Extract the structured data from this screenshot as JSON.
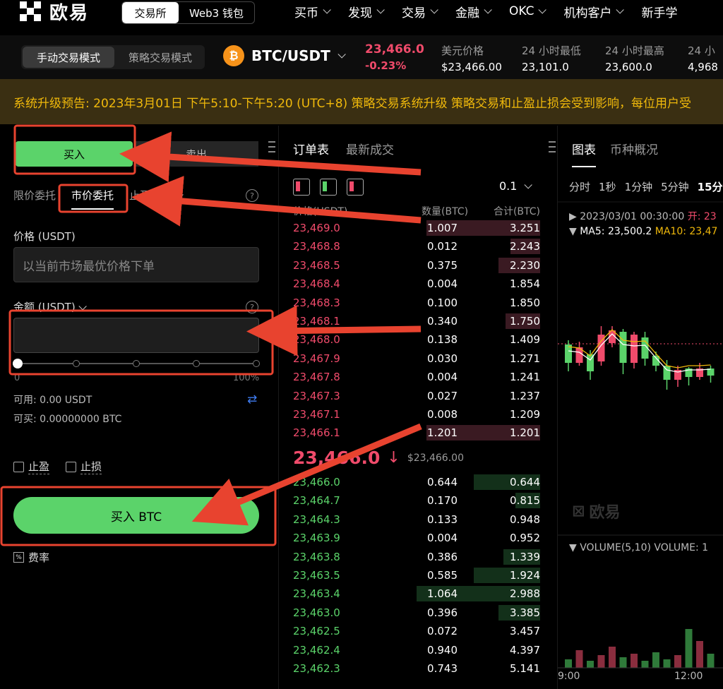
{
  "nav": {
    "logo_text": "欧易",
    "exchange_tab": "交易所",
    "web3_tab": "Web3 钱包",
    "menu": [
      "买币",
      "发现",
      "交易",
      "金融",
      "OKC",
      "机构客户",
      "新手学"
    ]
  },
  "ticker": {
    "mode_manual": "手动交易模式",
    "mode_strategy": "策略交易模式",
    "coin_symbol": "₿",
    "pair": "BTC/USDT",
    "last_price": "23,466.0",
    "change": "-0.23%",
    "stats": [
      {
        "label": "美元价格",
        "value": "$23,466.00"
      },
      {
        "label": "24 小时最低",
        "value": "23,101.0"
      },
      {
        "label": "24 小时最高",
        "value": "23,600.0"
      },
      {
        "label": "24 小",
        "value": "4,968"
      }
    ]
  },
  "announcement": "系统升级预告: 2023年3月01日 下午5:10-下午5:20 (UTC+8) 策略交易系统升级 策略交易和止盈止损会受到影响，每位用户受",
  "order": {
    "buy_tab": "买入",
    "sell_tab": "卖出",
    "type_limit": "限价委托",
    "type_market": "市价委托",
    "type_tpsl": "止盈止损",
    "price_label": "价格 (USDT)",
    "price_placeholder": "以当前市场最优价格下单",
    "amount_label": "金额 (USDT)",
    "slider_min": "0",
    "slider_max": "100%",
    "slider_value": 0,
    "available": "可用: 0.00 USDT",
    "can_buy": "可买: 0.00000000 BTC",
    "take_profit": "止盈",
    "stop_loss": "止损",
    "submit": "买入 BTC",
    "fee": "费率"
  },
  "book": {
    "tab_orderbook": "订单表",
    "tab_trades": "最新成交",
    "precision": "0.1",
    "col_price": "价格(USDT)",
    "col_amount": "数量(BTC)",
    "col_total": "合计(BTC)",
    "asks": [
      {
        "price": "23,469.0",
        "amount": "1.007",
        "total": "3.251",
        "depth": 0.46
      },
      {
        "price": "23,468.8",
        "amount": "0.012",
        "total": "2.243",
        "depth": 0.12
      },
      {
        "price": "23,468.5",
        "amount": "0.375",
        "total": "2.230",
        "depth": 0.17
      },
      {
        "price": "23,468.4",
        "amount": "0.004",
        "total": "1.854",
        "depth": 0.0
      },
      {
        "price": "23,468.3",
        "amount": "0.100",
        "total": "1.850",
        "depth": 0.0
      },
      {
        "price": "23,468.1",
        "amount": "0.340",
        "total": "1.750",
        "depth": 0.14
      },
      {
        "price": "23,468.0",
        "amount": "0.138",
        "total": "1.409",
        "depth": 0.0
      },
      {
        "price": "23,467.9",
        "amount": "0.030",
        "total": "1.271",
        "depth": 0.0
      },
      {
        "price": "23,467.8",
        "amount": "0.004",
        "total": "1.241",
        "depth": 0.0
      },
      {
        "price": "23,467.3",
        "amount": "0.027",
        "total": "1.237",
        "depth": 0.0
      },
      {
        "price": "23,467.1",
        "amount": "0.008",
        "total": "1.209",
        "depth": 0.0
      },
      {
        "price": "23,466.1",
        "amount": "1.201",
        "total": "1.201",
        "depth": 0.46
      }
    ],
    "mid_price": "23,466.0",
    "mid_arrow": "↓",
    "mid_usd": "$23,466.00",
    "bids": [
      {
        "price": "23,466.0",
        "amount": "0.644",
        "total": "0.644",
        "depth": 0.27
      },
      {
        "price": "23,464.7",
        "amount": "0.170",
        "total": "0.815",
        "depth": 0.1
      },
      {
        "price": "23,464.3",
        "amount": "0.133",
        "total": "0.948",
        "depth": 0.0
      },
      {
        "price": "23,463.9",
        "amount": "0.004",
        "total": "0.952",
        "depth": 0.0
      },
      {
        "price": "23,463.8",
        "amount": "0.386",
        "total": "1.339",
        "depth": 0.15
      },
      {
        "price": "23,463.5",
        "amount": "0.585",
        "total": "1.924",
        "depth": 0.27
      },
      {
        "price": "23,463.4",
        "amount": "1.064",
        "total": "2.988",
        "depth": 0.5
      },
      {
        "price": "23,463.0",
        "amount": "0.396",
        "total": "3.385",
        "depth": 0.17
      },
      {
        "price": "23,462.5",
        "amount": "0.072",
        "total": "3.457",
        "depth": 0.0
      },
      {
        "price": "23,462.4",
        "amount": "0.940",
        "total": "4.397",
        "depth": 0.0
      },
      {
        "price": "23,462.3",
        "amount": "0.743",
        "total": "5.141",
        "depth": 0.0
      }
    ]
  },
  "chart": {
    "tab_chart": "图表",
    "tab_info": "币种概况",
    "intervals": [
      "分时",
      "1秒",
      "1分钟",
      "5分钟",
      "15分钟"
    ],
    "ohlc_date": "2023/03/01 00:30:00",
    "ohlc_open_label": "开: 23",
    "ma5": "MA5: 23,500.2",
    "ma10": "MA10: 23,47",
    "watermark": "欧易",
    "volume_label": "VOLUME(5,10)  VOLUME: 1",
    "x_labels": [
      "9:00",
      "12:00"
    ],
    "candles": [
      {
        "o": 0.65,
        "c": 0.52,
        "h": 0.68,
        "l": 0.46,
        "up": true
      },
      {
        "o": 0.52,
        "c": 0.63,
        "h": 0.67,
        "l": 0.5,
        "up": false
      },
      {
        "o": 0.58,
        "c": 0.46,
        "h": 0.61,
        "l": 0.4,
        "up": true
      },
      {
        "o": 0.53,
        "c": 0.72,
        "h": 0.78,
        "l": 0.5,
        "up": false
      },
      {
        "o": 0.66,
        "c": 0.75,
        "h": 0.78,
        "l": 0.63,
        "up": false
      },
      {
        "o": 0.74,
        "c": 0.52,
        "h": 0.76,
        "l": 0.44,
        "up": true
      },
      {
        "o": 0.52,
        "c": 0.72,
        "h": 0.74,
        "l": 0.48,
        "up": false
      },
      {
        "o": 0.7,
        "c": 0.55,
        "h": 0.74,
        "l": 0.5,
        "up": true
      },
      {
        "o": 0.57,
        "c": 0.5,
        "h": 0.6,
        "l": 0.46,
        "up": true
      },
      {
        "o": 0.5,
        "c": 0.4,
        "h": 0.54,
        "l": 0.33,
        "up": true
      },
      {
        "o": 0.4,
        "c": 0.47,
        "h": 0.5,
        "l": 0.35,
        "up": false
      },
      {
        "o": 0.48,
        "c": 0.42,
        "h": 0.49,
        "l": 0.36,
        "up": true
      },
      {
        "o": 0.42,
        "c": 0.48,
        "h": 0.52,
        "l": 0.4,
        "up": false
      },
      {
        "o": 0.48,
        "c": 0.43,
        "h": 0.5,
        "l": 0.38,
        "up": true
      }
    ],
    "volumes": [
      0.12,
      0.25,
      0.1,
      0.18,
      0.3,
      0.15,
      0.2,
      0.1,
      0.22,
      0.12,
      0.18,
      0.55,
      0.38,
      0.2
    ]
  }
}
